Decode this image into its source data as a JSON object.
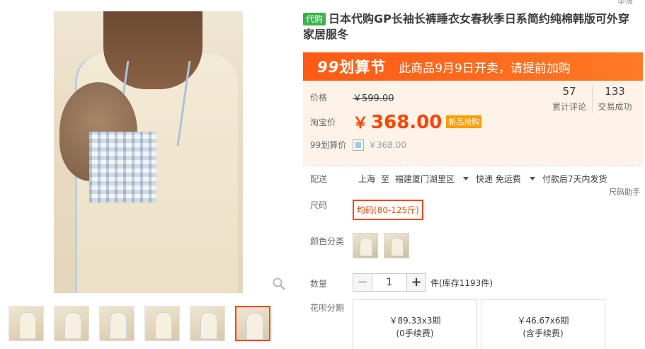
{
  "top_cut_text": "举报",
  "product": {
    "tag": "代购",
    "title": "日本代购GP长袖长裤睡衣女春秋季日系简约纯棉韩版可外穿家居服冬"
  },
  "promo": {
    "logo_num": "99",
    "logo_text": "划算节",
    "message": "此商品9月9日开卖，请提前加购"
  },
  "price": {
    "label": "价格",
    "original": "￥599.00",
    "tb_label": "淘宝价",
    "yen": "￥",
    "current": "368.00",
    "new_badge": "新品抢购",
    "event_label": "99划算价",
    "event_price": "￥368.00"
  },
  "stats": [
    {
      "num": "57",
      "caption": "累计评论"
    },
    {
      "num": "133",
      "caption": "交易成功"
    }
  ],
  "shipping": {
    "label": "配送",
    "from": "上海",
    "to_word": "至",
    "destination": "福建厦门湖里区",
    "delivery": "快递 免运费",
    "dispatch": "付款后7天内发货"
  },
  "size": {
    "label": "尺码",
    "option": "均码(80-125斤)",
    "helper": "尺码助手"
  },
  "color": {
    "label": "颜色分类"
  },
  "quantity": {
    "label": "数量",
    "minus": "−",
    "value": "1",
    "plus": "+",
    "stock": "件(库存1193件)"
  },
  "installment": {
    "label": "花呗分期",
    "options": [
      {
        "amount": "￥89.33x3期",
        "fee": "(0手续费)"
      },
      {
        "amount": "￥46.67x6期",
        "fee": "(含手续费)"
      }
    ]
  },
  "colors": {
    "accent": "#ff4400",
    "promo": "#ff6a1e",
    "price_bg": "#fff2e8",
    "badge_green": "#3cb34a"
  }
}
